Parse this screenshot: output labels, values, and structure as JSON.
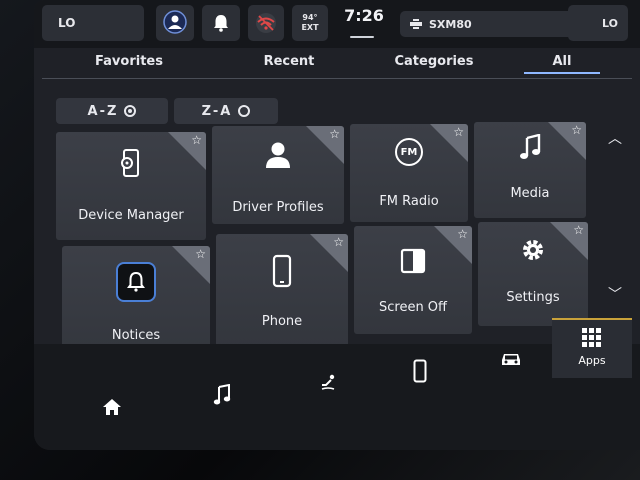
{
  "status_bar": {
    "left_temp": "LO",
    "right_temp": "LO",
    "outside_temp_value": "94°",
    "outside_temp_label": "EXT",
    "time": "7:26",
    "radio_station": "SXM80"
  },
  "tabs": [
    {
      "label": "Favorites"
    },
    {
      "label": "Recent"
    },
    {
      "label": "Categories"
    },
    {
      "label": "All",
      "selected": true
    }
  ],
  "sort": {
    "az_label": "A-Z",
    "za_label": "Z-A",
    "selected": "A-Z"
  },
  "apps": [
    {
      "label": "Device Manager",
      "icon": "phone-gear-icon"
    },
    {
      "label": "Driver Profiles",
      "icon": "person-icon"
    },
    {
      "label": "FM Radio",
      "icon": "fm-icon",
      "icon_text": "FM"
    },
    {
      "label": "Media",
      "icon": "music-note-icon"
    },
    {
      "label": "Notices",
      "icon": "bell-icon"
    },
    {
      "label": "Phone",
      "icon": "phone-icon"
    },
    {
      "label": "Screen Off",
      "icon": "screen-off-icon"
    },
    {
      "label": "Settings",
      "icon": "gear-icon"
    }
  ],
  "dock": {
    "apps_label": "Apps"
  },
  "colors": {
    "accent_tab": "#8fb8ff",
    "apps_accent": "#c9a23a",
    "notice_ring": "#4a7fd6"
  }
}
